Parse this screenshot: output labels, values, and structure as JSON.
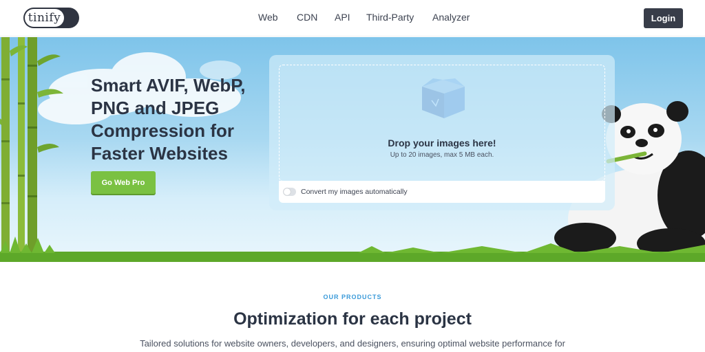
{
  "header": {
    "logo_text": "tinify",
    "nav": [
      "Web",
      "CDN",
      "API",
      "Third-Party",
      "Analyzer"
    ],
    "login_label": "Login"
  },
  "hero": {
    "headline": "Smart AVIF, WebP, PNG and JPEG Compression for Faster Websites",
    "cta_label": "Go Web Pro",
    "drop_title": "Drop your images here!",
    "drop_subtitle": "Up to 20 images, max 5 MB each.",
    "toggle_label": "Convert my images automatically",
    "toggle_on": false
  },
  "products": {
    "eyebrow": "OUR PRODUCTS",
    "title": "Optimization for each project",
    "description": "Tailored solutions for website owners, developers, and designers, ensuring optimal website performance for"
  },
  "colors": {
    "accent_green": "#7ac142",
    "dark": "#383d49",
    "eyebrow_blue": "#3a9ad9"
  },
  "icons": [
    "box-icon",
    "panda-mascot",
    "bamboo-illustration",
    "grass-illustration",
    "cloud-illustration"
  ]
}
